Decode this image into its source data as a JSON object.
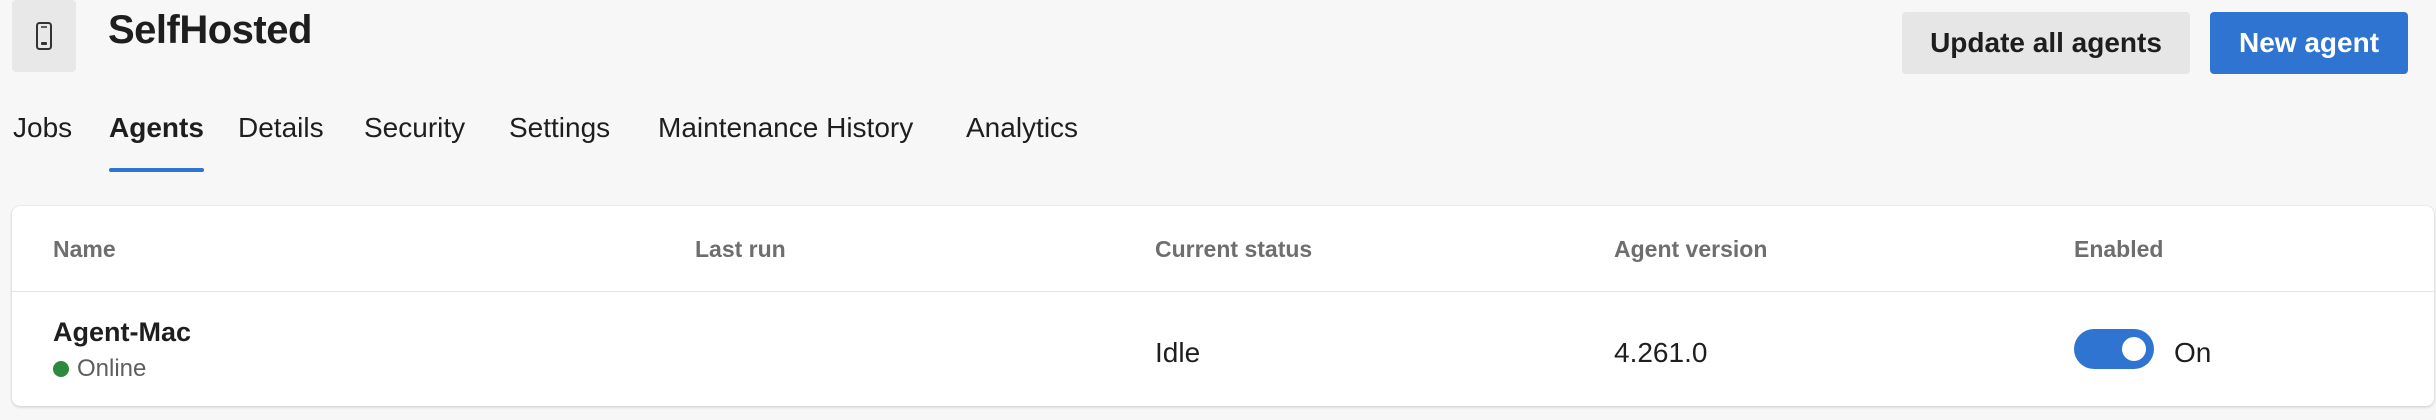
{
  "header": {
    "pool_icon": "mobile-device-icon",
    "title": "SelfHosted",
    "update_all_label": "Update all agents",
    "new_agent_label": "New agent"
  },
  "tabs": [
    {
      "label": "Jobs",
      "active": false
    },
    {
      "label": "Agents",
      "active": true
    },
    {
      "label": "Details",
      "active": false
    },
    {
      "label": "Security",
      "active": false
    },
    {
      "label": "Settings",
      "active": false
    },
    {
      "label": "Maintenance History",
      "active": false
    },
    {
      "label": "Analytics",
      "active": false
    }
  ],
  "table": {
    "columns": [
      "Name",
      "Last run",
      "Current status",
      "Agent version",
      "Enabled"
    ],
    "rows": [
      {
        "name": "Agent-Mac",
        "presence": "Online",
        "last_run": "",
        "current_status": "Idle",
        "agent_version": "4.261.0",
        "enabled": true,
        "enabled_label": "On"
      }
    ]
  },
  "colors": {
    "accent": "#2f74d0",
    "online": "#2b8a3e",
    "background": "#f7f7f7"
  }
}
